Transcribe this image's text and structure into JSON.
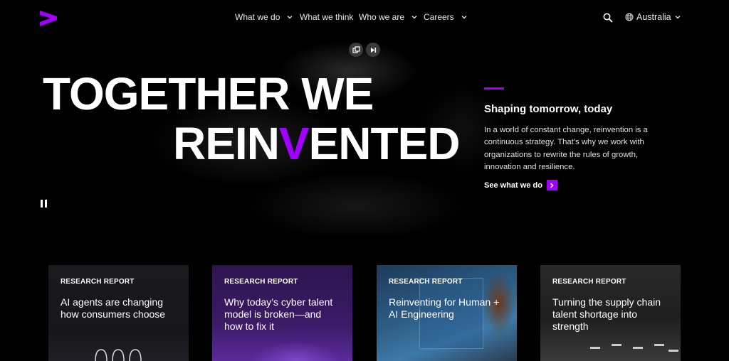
{
  "header": {
    "nav": [
      {
        "label": "What we do",
        "has_menu": true
      },
      {
        "label": "What we think",
        "has_menu": false
      },
      {
        "label": "Who we are",
        "has_menu": true
      },
      {
        "label": "Careers",
        "has_menu": true
      }
    ],
    "region": "Australia"
  },
  "hero": {
    "headline_line1": "TOGETHER WE",
    "headline_line2_pre": "REIN",
    "headline_line2_accent": "V",
    "headline_line2_post": "ENTED",
    "subtitle": "Shaping tomorrow, today",
    "body": "In a world of constant change, reinvention is a continuous strategy. That’s why we work with organizations to rewrite the rules of growth, innovation and resilience.",
    "cta": "See what we do"
  },
  "cards": [
    {
      "tag": "RESEARCH REPORT",
      "title": "AI agents are changing how consumers choose"
    },
    {
      "tag": "RESEARCH REPORT",
      "title": "Why today’s cyber talent model is broken—and how to fix it"
    },
    {
      "tag": "RESEARCH REPORT",
      "title": "Reinventing for Human + AI Engineering"
    },
    {
      "tag": "RESEARCH REPORT",
      "title": "Turning the supply chain talent shortage into strength"
    }
  ],
  "colors": {
    "accent": "#a100ff",
    "background": "#000000"
  }
}
